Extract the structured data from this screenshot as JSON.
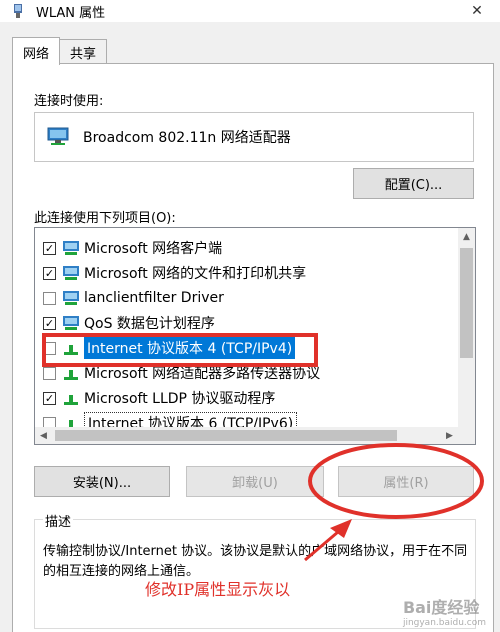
{
  "window": {
    "title": "WLAN 属性"
  },
  "tabs": [
    {
      "label": "网络",
      "active": true
    },
    {
      "label": "共享",
      "active": false
    }
  ],
  "connect_using": {
    "label": "连接时使用:",
    "adapter": "Broadcom 802.11n 网络适配器"
  },
  "configure_button": "配置(C)...",
  "items_label": "此连接使用下列项目(O):",
  "items": [
    {
      "label": "Microsoft 网络客户端",
      "checked": true,
      "icon": "network-client-icon"
    },
    {
      "label": "Microsoft 网络的文件和打印机共享",
      "checked": true,
      "icon": "network-service-icon"
    },
    {
      "label": "lanclientfilter Driver",
      "checked": false,
      "icon": "network-service-icon"
    },
    {
      "label": "QoS 数据包计划程序",
      "checked": true,
      "icon": "network-service-icon"
    },
    {
      "label": "Internet 协议版本 4 (TCP/IPv4)",
      "checked": false,
      "icon": "protocol-icon",
      "selected": true
    },
    {
      "label": "Microsoft 网络适配器多路传送器协议",
      "checked": false,
      "icon": "protocol-icon"
    },
    {
      "label": "Microsoft LLDP 协议驱动程序",
      "checked": true,
      "icon": "protocol-icon"
    },
    {
      "label": "Internet 协议版本 6 (TCP/IPv6)",
      "checked": false,
      "icon": "protocol-icon",
      "focused": true
    }
  ],
  "buttons": {
    "install": "安装(N)...",
    "uninstall": "卸载(U)",
    "properties": "属性(R)"
  },
  "description": {
    "legend": "描述",
    "text": "传输控制协议/Internet 协议。该协议是默认的广域网络协议，用于在不同的相互连接的网络上通信。"
  },
  "annotation": "修改IP属性显示灰以",
  "watermark": {
    "main": "Bai度经验",
    "sub": "jingyan.baidu.com"
  },
  "colors": {
    "selection": "#0078d7",
    "annotation": "#e0312a"
  }
}
